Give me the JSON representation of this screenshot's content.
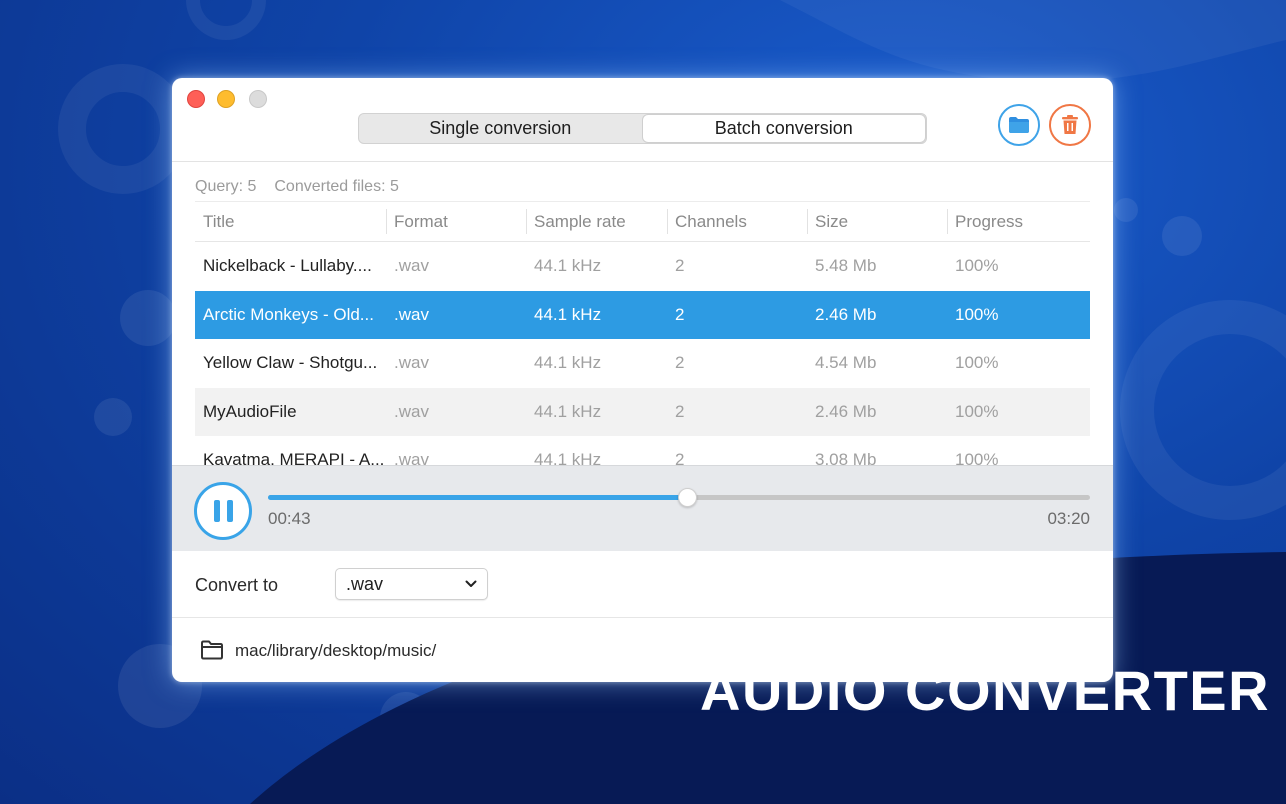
{
  "tabs": [
    {
      "label": "Single conversion",
      "active": false
    },
    {
      "label": "Batch conversion",
      "active": true
    }
  ],
  "toolbar": {
    "open_folder_icon": "folder-icon",
    "delete_icon": "trash-icon",
    "accent_blue": "#3fa3e8",
    "accent_orange": "#f07745"
  },
  "stats": {
    "query": "Query: 5",
    "converted": "Converted files: 5"
  },
  "table": {
    "columns": [
      "Title",
      "Format",
      "Sample rate",
      "Channels",
      "Size",
      "Progress"
    ],
    "rows": [
      {
        "title": "Nickelback - Lullaby....",
        "format": ".wav",
        "rate": "44.1 kHz",
        "channels": "2",
        "size": "5.48 Mb",
        "progress": "100%"
      },
      {
        "title": "Arctic Monkeys - Old...",
        "format": ".wav",
        "rate": "44.1 kHz",
        "channels": "2",
        "size": "2.46 Mb",
        "progress": "100%"
      },
      {
        "title": "Yellow Claw - Shotgu...",
        "format": ".wav",
        "rate": "44.1 kHz",
        "channels": "2",
        "size": "4.54 Mb",
        "progress": "100%"
      },
      {
        "title": "MyAudioFile",
        "format": ".wav",
        "rate": "44.1 kHz",
        "channels": "2",
        "size": "2.46 Mb",
        "progress": "100%"
      },
      {
        "title": "Kavatma, MERAPI - A...",
        "format": ".wav",
        "rate": "44.1 kHz",
        "channels": "2",
        "size": "3.08 Mb",
        "progress": "100%"
      }
    ],
    "selected_index": 1
  },
  "player": {
    "current_time": "00:43",
    "total_time": "03:20",
    "progress_fraction": 0.51
  },
  "convert": {
    "label": "Convert to",
    "selected_format": ".wav"
  },
  "output": {
    "path": "mac/library/desktop/music/"
  },
  "headline": "AUDIO CONVERTER"
}
